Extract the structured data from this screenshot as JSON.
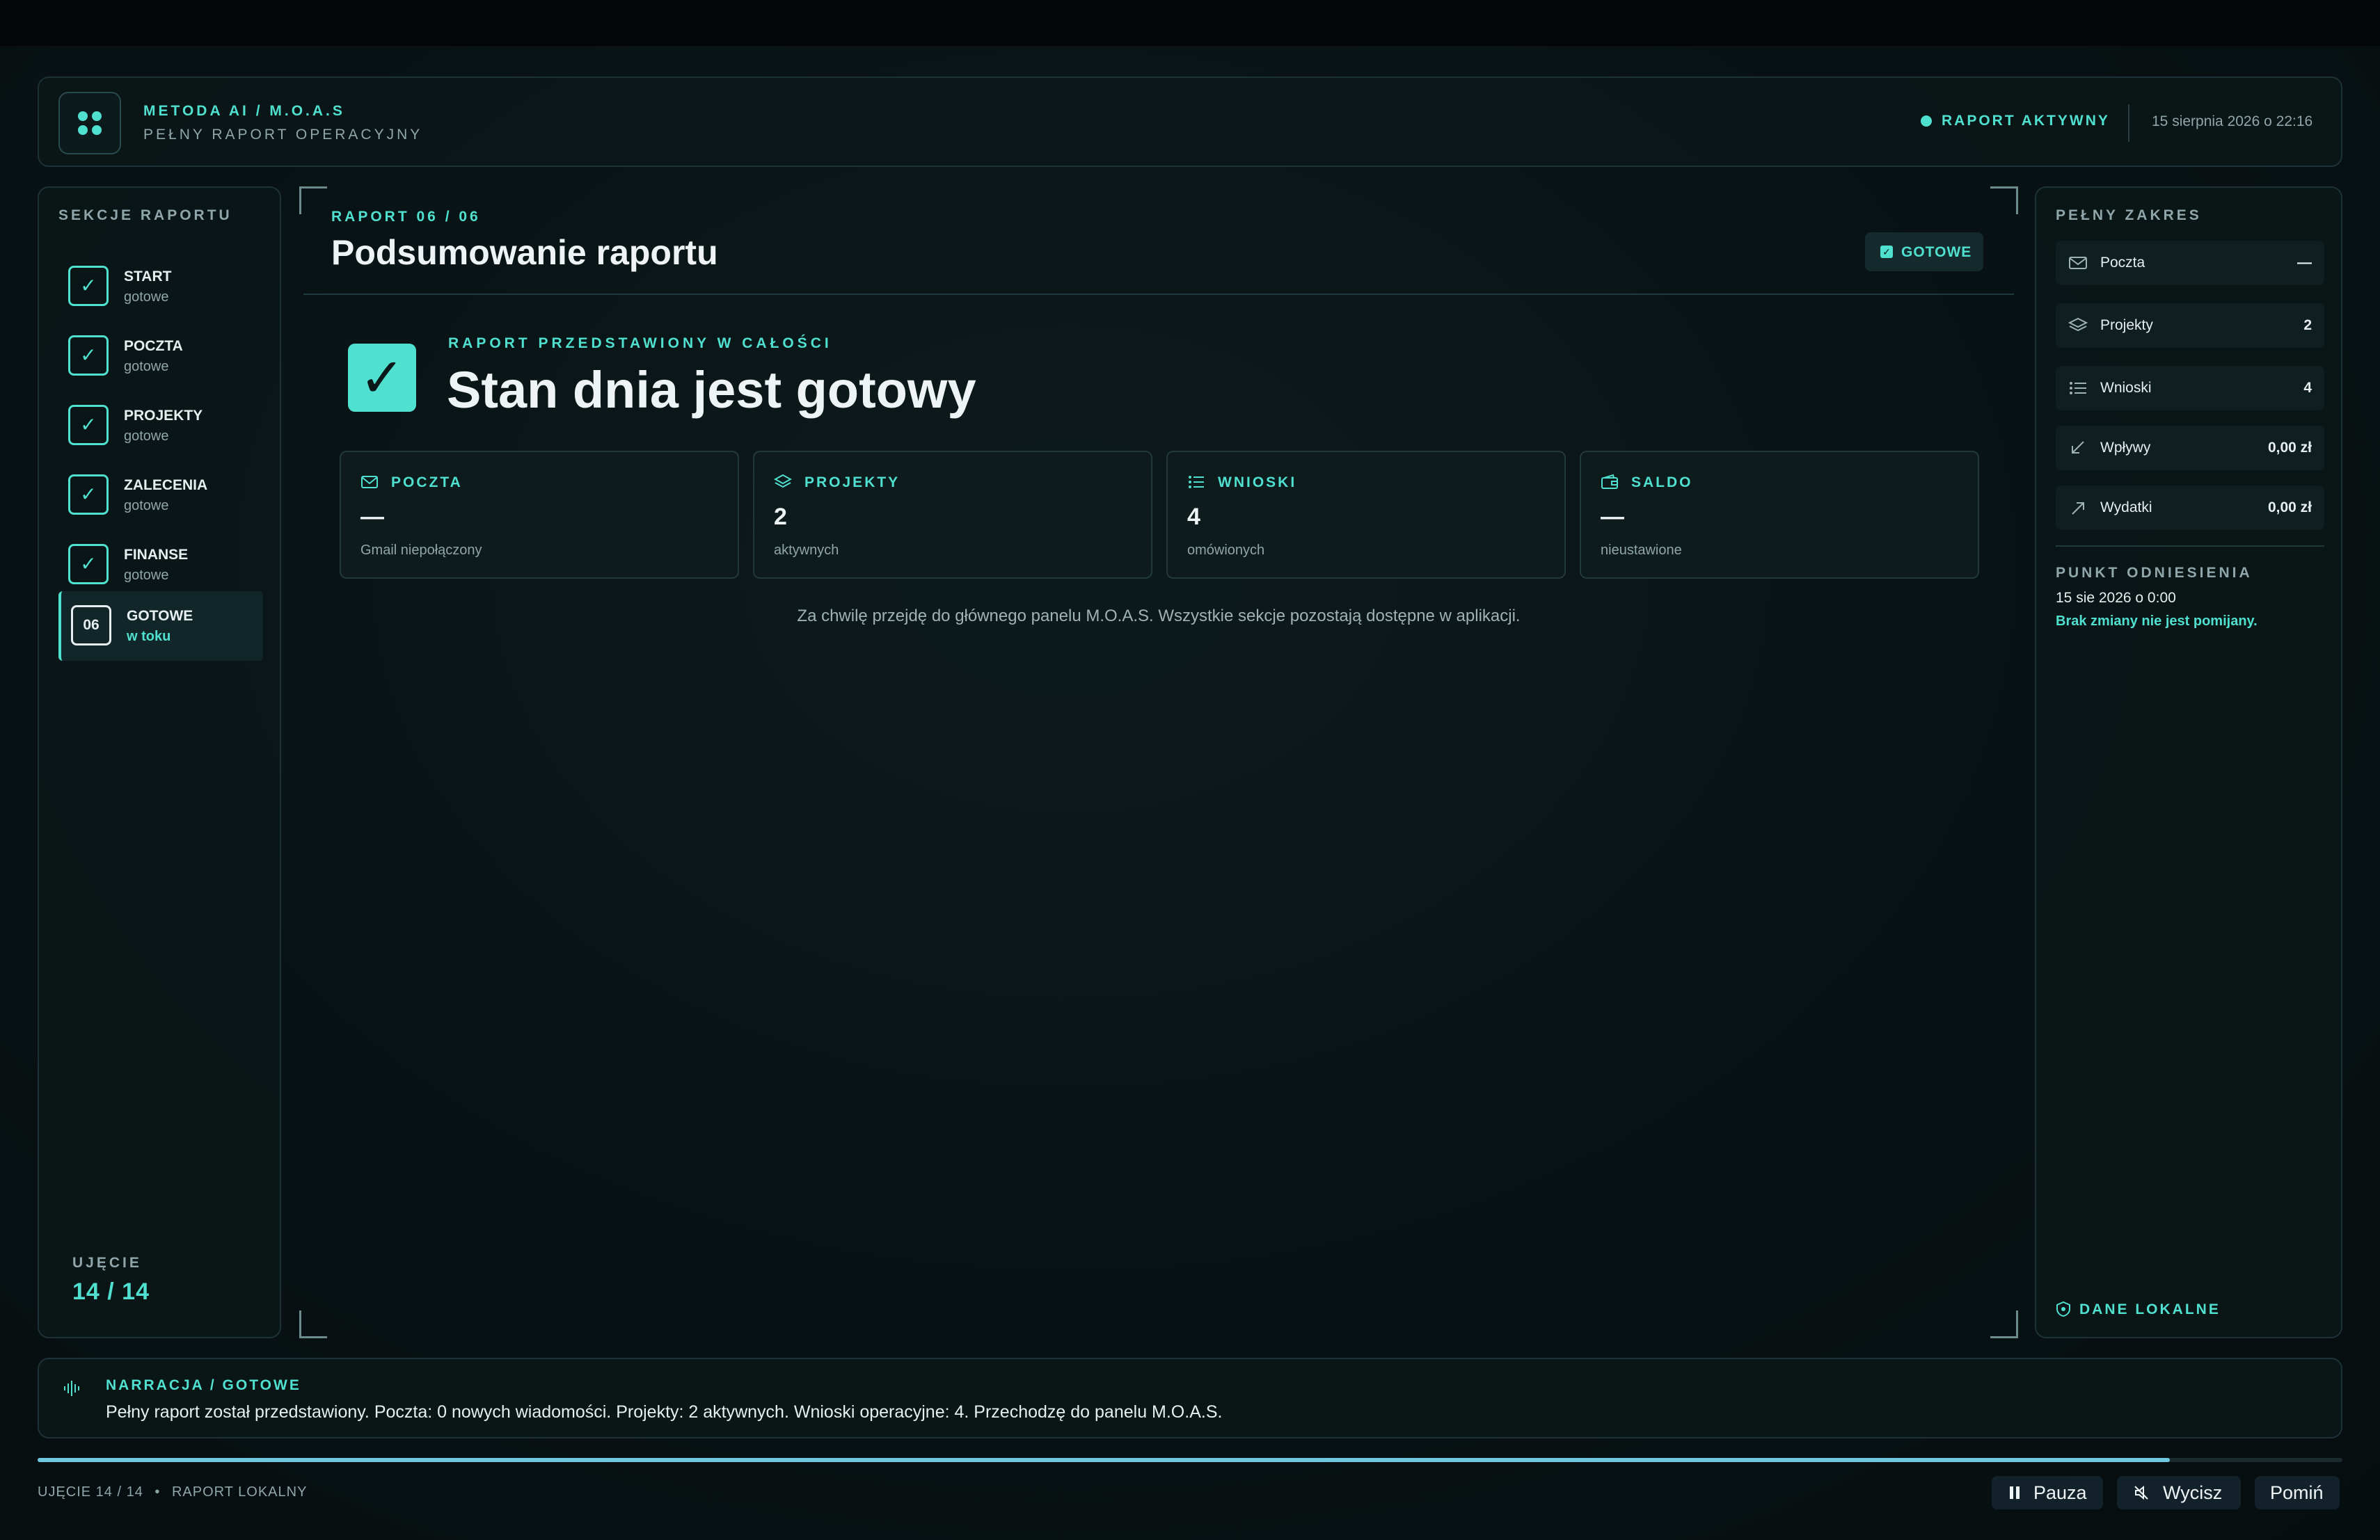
{
  "header": {
    "brand_title": "METODA AI / M.O.A.S",
    "brand_subtitle": "PEŁNY RAPORT OPERACYJNY",
    "status": "RAPORT AKTYWNY",
    "datetime": "15 sierpnia 2026 o 22:16",
    "accent_color": "#4fe0cf"
  },
  "sidebar": {
    "title": "SEKCJE RAPORTU",
    "items": [
      {
        "icon": "check-icon",
        "name": "START",
        "status": "gotowe"
      },
      {
        "icon": "check-icon",
        "name": "POCZTA",
        "status": "gotowe"
      },
      {
        "icon": "check-icon",
        "name": "PROJEKTY",
        "status": "gotowe"
      },
      {
        "icon": "check-icon",
        "name": "ZALECENIA",
        "status": "gotowe"
      },
      {
        "icon": "check-icon",
        "name": "FINANSE",
        "status": "gotowe"
      },
      {
        "number": "06",
        "name": "GOTOWE",
        "status": "w toku",
        "active": true
      }
    ],
    "shot_label": "UJĘCIE",
    "shot_value": "14 / 14"
  },
  "main": {
    "kicker": "RAPORT 06 / 06",
    "title": "Podsumowanie raportu",
    "badge": "GOTOWE",
    "hero_kicker": "RAPORT PRZEDSTAWIONY W CAŁOŚCI",
    "hero_title": "Stan dnia jest gotowy",
    "stats": [
      {
        "icon": "mail-icon",
        "name": "POCZTA",
        "value": "—",
        "sub": "Gmail niepołączony"
      },
      {
        "icon": "layers-icon",
        "name": "PROJEKTY",
        "value": "2",
        "sub": "aktywnych"
      },
      {
        "icon": "list-icon",
        "name": "WNIOSKI",
        "value": "4",
        "sub": "omówionych"
      },
      {
        "icon": "wallet-icon",
        "name": "SALDO",
        "value": "—",
        "sub": "nieustawione"
      }
    ],
    "note": "Za chwilę przejdę do głównego panelu M.O.A.S. Wszystkie sekcje pozostają dostępne w aplikacji."
  },
  "right": {
    "title": "PEŁNY ZAKRES",
    "rows": [
      {
        "icon": "mail-icon",
        "label": "Poczta",
        "value": "—"
      },
      {
        "icon": "layers-icon",
        "label": "Projekty",
        "value": "2"
      },
      {
        "icon": "list-icon",
        "label": "Wnioski",
        "value": "4"
      },
      {
        "icon": "arrow-down-left-icon",
        "label": "Wpływy",
        "value": "0,00 zł"
      },
      {
        "icon": "arrow-up-right-icon",
        "label": "Wydatki",
        "value": "0,00 zł"
      }
    ],
    "ref_title": "PUNKT ODNIESIENIA",
    "ref_date": "15 sie 2026 o 0:00",
    "ref_note": "Brak zmiany nie jest pomijany.",
    "local_label": "DANE LOKALNE"
  },
  "narration": {
    "label": "NARRACJA / GOTOWE",
    "text": "Pełny raport został przedstawiony. Poczta: 0 nowych wiadomości. Projekty: 2 aktywnych. Wnioski operacyjne: 4. Przechodzę do panelu M.O.A.S."
  },
  "footer": {
    "shot": "UJĘCIE 14 / 14",
    "separator": "•",
    "mode": "RAPORT LOKALNY",
    "progress_fraction": 0.925,
    "pause_label": "Pauza",
    "mute_label": "Wycisz",
    "skip_label": "Pomiń"
  }
}
